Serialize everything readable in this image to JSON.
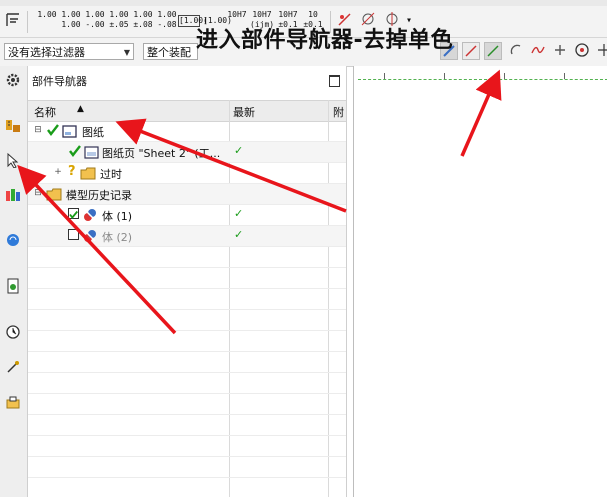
{
  "overlay": {
    "annotation_text": "进入部件导航器-去掉单色"
  },
  "toolbar": {
    "dim_buttons": [
      {
        "top": "1.00",
        "bottom": ""
      },
      {
        "top": "1.00",
        "bottom": "1.00"
      },
      {
        "top": "1.00",
        "bottom": "-.00"
      },
      {
        "top": "1.00",
        "bottom": "±.05"
      },
      {
        "top": "1.00",
        "bottom": "±.08"
      },
      {
        "top": "1.00",
        "bottom": "-.08"
      },
      {
        "top": "[1.00]",
        "bottom": ""
      },
      {
        "top": "(1.00)",
        "bottom": ""
      },
      {
        "top": "10H7",
        "bottom": ""
      },
      {
        "top": "10H7",
        "bottom": "(ijm)"
      },
      {
        "top": "10H7",
        "bottom": "±0.1"
      },
      {
        "top": "10",
        "bottom": "±0.1"
      }
    ]
  },
  "filterbar": {
    "filter_select": "没有选择过滤器",
    "assembly_select": "整个装配"
  },
  "navigator": {
    "title": "部件导航器",
    "columns": {
      "name": "名称",
      "latest": "最新",
      "third": "附"
    },
    "rows": [
      {
        "label": "图纸",
        "latest": ""
      },
      {
        "label": "图纸页 \"Sheet 2\" (工...",
        "latest": "✓"
      },
      {
        "label": "过时",
        "latest": ""
      },
      {
        "label": "模型历史记录",
        "latest": ""
      },
      {
        "label": "体 (1)",
        "latest": "✓"
      },
      {
        "label": "体 (2)",
        "latest": "✓"
      }
    ]
  },
  "colors": {
    "check_green": "#1a9c1a",
    "arrow_red": "#e8151b",
    "folder_yellow": "#f2c14e"
  }
}
